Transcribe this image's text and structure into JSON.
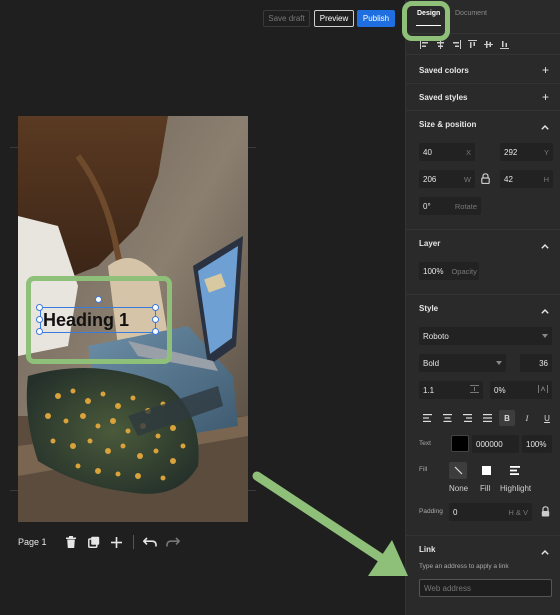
{
  "topbar": {
    "save_draft": "Save draft",
    "preview": "Preview",
    "publish": "Publish",
    "publish_color": "#1f6fe0"
  },
  "canvas": {
    "heading_text": "Heading 1",
    "highlight_color": "#8fc07a",
    "selection_color": "#3a7be0"
  },
  "pagebar": {
    "page_label": "Page 1",
    "icons": [
      "trash-icon",
      "duplicate-icon",
      "plus-icon",
      "undo-icon",
      "redo-icon"
    ]
  },
  "panel": {
    "tabs": [
      "Design",
      "Document"
    ],
    "align_icons": [
      "align-left-icon",
      "align-center-h-icon",
      "align-right-icon",
      "align-top-icon",
      "align-middle-v-icon",
      "align-bottom-icon"
    ],
    "saved_colors": "Saved colors",
    "saved_styles": "Saved styles",
    "size_position": {
      "title": "Size & position",
      "x": "40",
      "x_label": "X",
      "y": "292",
      "y_label": "Y",
      "w": "206",
      "w_label": "W",
      "h": "42",
      "h_label": "H",
      "rotate": "0°",
      "rotate_label": "Rotate"
    },
    "layer": {
      "title": "Layer",
      "opacity": "100%",
      "opacity_label": "Opacity"
    },
    "style": {
      "title": "Style",
      "font": "Roboto",
      "weight": "Bold",
      "size": "36",
      "line_height": "1.1",
      "letter_spacing": "0%",
      "text_label": "Text",
      "text_color_hex": "000000",
      "text_opacity": "100%",
      "text_color": "#000000",
      "fill_label": "Fill",
      "fill_options": [
        "None",
        "Fill",
        "Highlight"
      ],
      "padding_label": "Padding",
      "padding_value": "0",
      "padding_suffix": "H & V"
    },
    "link": {
      "title": "Link",
      "hint": "Type an address to apply a link",
      "placeholder": "Web address"
    }
  }
}
